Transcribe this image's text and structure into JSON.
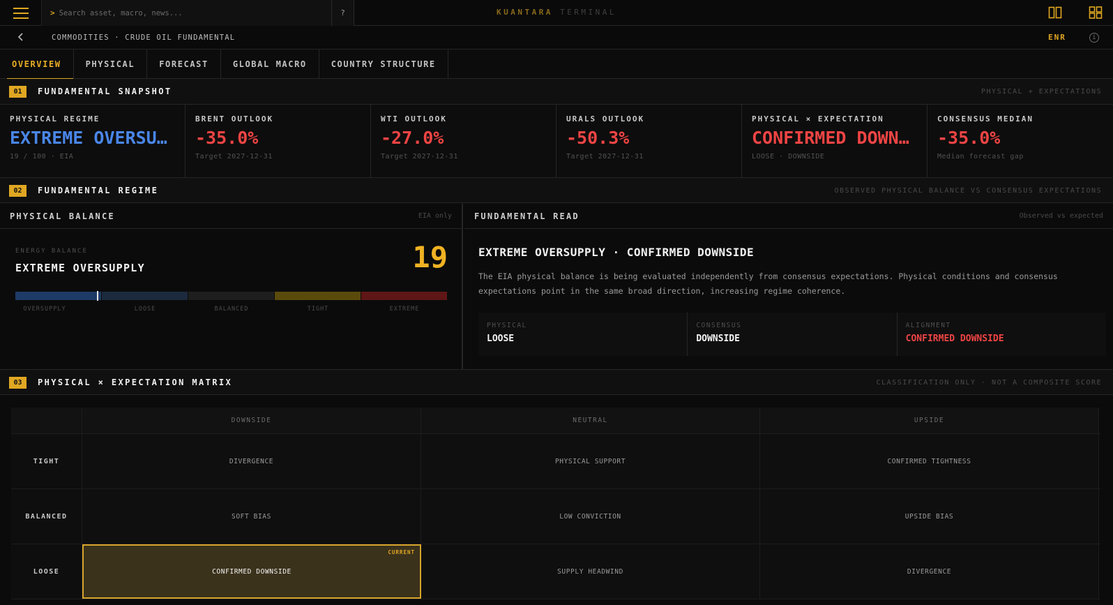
{
  "app": {
    "brand_primary": "KUANTARA",
    "brand_secondary": "TERMINAL",
    "search_placeholder": "Search asset, macro, news...",
    "search_prompt": ">",
    "help_label": "?",
    "accent_color": "#e0a722"
  },
  "breadcrumb": {
    "back_icon": "chevron-left-icon",
    "text": "COMMODITIES · CRUDE OIL FUNDAMENTAL",
    "sector": "ENR",
    "info_label": "i"
  },
  "tabs": [
    {
      "label": "OVERVIEW",
      "active": true
    },
    {
      "label": "PHYSICAL",
      "active": false
    },
    {
      "label": "FORECAST",
      "active": false
    },
    {
      "label": "GLOBAL MACRO",
      "active": false
    },
    {
      "label": "COUNTRY STRUCTURE",
      "active": false
    }
  ],
  "sections": {
    "s1": {
      "num": "01",
      "title": "FUNDAMENTAL SNAPSHOT",
      "note": "PHYSICAL + EXPECTATIONS"
    },
    "s2": {
      "num": "02",
      "title": "FUNDAMENTAL REGIME",
      "note": "OBSERVED PHYSICAL BALANCE VS CONSENSUS EXPECTATIONS"
    },
    "s3": {
      "num": "03",
      "title": "PHYSICAL × EXPECTATION MATRIX",
      "note": "CLASSIFICATION ONLY · NOT A COMPOSITE SCORE"
    }
  },
  "kpis": [
    {
      "label": "PHYSICAL REGIME",
      "value": "EXTREME OVERSUPPLY",
      "sub": "19 / 100 · EIA",
      "color": "blue"
    },
    {
      "label": "BRENT OUTLOOK",
      "value": "-35.0%",
      "sub": "Target 2027-12-31",
      "color": "red"
    },
    {
      "label": "WTI OUTLOOK",
      "value": "-27.0%",
      "sub": "Target 2027-12-31",
      "color": "red"
    },
    {
      "label": "URALS OUTLOOK",
      "value": "-50.3%",
      "sub": "Target 2027-12-31",
      "color": "red"
    },
    {
      "label": "PHYSICAL × EXPECTATION",
      "value": "CONFIRMED DOWNSIDE",
      "sub": "LOOSE · DOWNSIDE",
      "color": "red"
    },
    {
      "label": "CONSENSUS MEDIAN",
      "value": "-35.0%",
      "sub": "Median forecast gap",
      "color": "red"
    }
  ],
  "physical_balance": {
    "title": "PHYSICAL BALANCE",
    "note": "EIA only",
    "label": "ENERGY BALANCE",
    "value": "EXTREME OVERSUPPLY",
    "score": "19",
    "score_value": 19,
    "scale_max": 100,
    "zone_labels": [
      "OVERSUPPLY",
      "LOOSE",
      "BALANCED",
      "TIGHT",
      "EXTREME"
    ],
    "zone_colors": [
      "#1e3a66",
      "#1c2a3e",
      "#1e1e1e",
      "#5a4a0c",
      "#5f1616"
    ]
  },
  "fundamental_read": {
    "title": "FUNDAMENTAL READ",
    "note": "Observed vs expected",
    "headline": "EXTREME OVERSUPPLY · CONFIRMED DOWNSIDE",
    "body": "The EIA physical balance is being evaluated independently from consensus expectations. Physical conditions and consensus expectations point in the same broad direction, increasing regime coherence.",
    "cells": [
      {
        "label": "PHYSICAL",
        "value": "LOOSE"
      },
      {
        "label": "CONSENSUS",
        "value": "DOWNSIDE"
      },
      {
        "label": "ALIGNMENT",
        "value": "CONFIRMED DOWNSIDE"
      }
    ]
  },
  "matrix": {
    "columns": [
      "DOWNSIDE",
      "NEUTRAL",
      "UPSIDE"
    ],
    "rows": [
      {
        "label": "TIGHT",
        "cells": [
          "DIVERGENCE",
          "PHYSICAL SUPPORT",
          "CONFIRMED TIGHTNESS"
        ]
      },
      {
        "label": "BALANCED",
        "cells": [
          "SOFT BIAS",
          "LOW CONVICTION",
          "UPSIDE BIAS"
        ]
      },
      {
        "label": "LOOSE",
        "cells": [
          "CONFIRMED DOWNSIDE",
          "SUPPLY HEADWIND",
          "DIVERGENCE"
        ]
      }
    ],
    "current_tag": "CURRENT",
    "current_row": 2,
    "current_col": 0
  }
}
